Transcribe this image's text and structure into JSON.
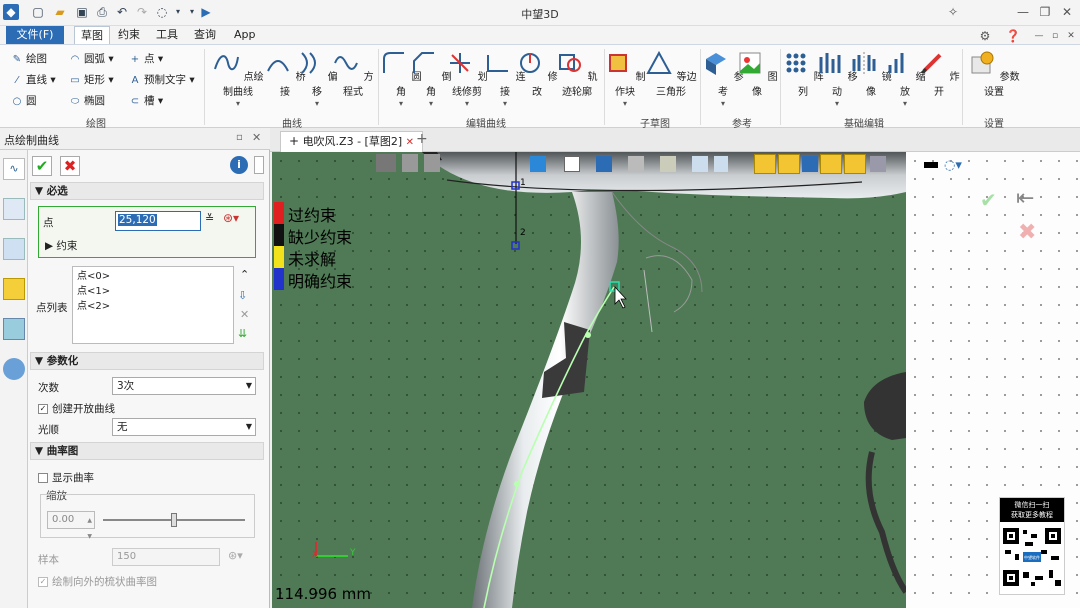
{
  "app": {
    "title": "中望3D"
  },
  "menu": {
    "file": "文件(F)",
    "tabs": [
      "草图",
      "约束",
      "工具",
      "查询",
      "App"
    ]
  },
  "ribbon": {
    "draw": {
      "items": [
        "绘图",
        "圆弧",
        "点",
        "直线",
        "矩形",
        "预制文字",
        "圆",
        "椭圆",
        "槽"
      ],
      "label": "绘图"
    },
    "curve": {
      "items": [
        "点绘制曲线",
        "桥接",
        "偏移",
        "方程式"
      ],
      "label": "曲线"
    },
    "edit": {
      "items": [
        "圆角",
        "倒角",
        "划线修剪",
        "连接",
        "修改",
        "轨迹轮廓"
      ],
      "label": "编辑曲线"
    },
    "subsketch": {
      "items": [
        "制作块",
        "等边三角形"
      ],
      "label": "子草图"
    },
    "ref": {
      "items": [
        "参考",
        "图像"
      ],
      "label": "参考"
    },
    "basic": {
      "items": [
        "阵列",
        "移动",
        "镜像",
        "缩放",
        "炸开"
      ],
      "label": "基础编辑"
    },
    "settings": {
      "items": [
        "参数设置"
      ],
      "label": "设置"
    }
  },
  "panel": {
    "title": "点绘制曲线",
    "required": "必选",
    "point_label": "点",
    "point_value": "25,120",
    "constraint": "约束",
    "points_label": "点列表",
    "points": [
      "点<0>",
      "点<1>",
      "点<2>"
    ],
    "param": "参数化",
    "degree_label": "次数",
    "degree_value": "3次",
    "open_curve": "创建开放曲线",
    "smooth_label": "光顺",
    "smooth_value": "无",
    "curvature": "曲率图",
    "show_curvature": "显示曲率",
    "scale_label": "缩放",
    "scale_value": "0.00",
    "sample_label": "样本",
    "sample_value": "150",
    "outer_comb": "绘制向外的梳状曲率图"
  },
  "doc": {
    "tab": "电吹风.Z3 - [草图2]",
    "add": "+"
  },
  "legend": {
    "items": [
      {
        "label": "过约束",
        "color": "#e02020"
      },
      {
        "label": "缺少约束",
        "color": "#111111"
      },
      {
        "label": "未求解",
        "color": "#f2e21c"
      },
      {
        "label": "明确约束",
        "color": "#2233cc"
      }
    ]
  },
  "viewport": {
    "measure": "114.996 mm",
    "pt1": "1",
    "pt2": "2",
    "axis_y": "Y",
    "axis_x": "X"
  },
  "qr": {
    "line1": "微信扫一扫",
    "line2": "获取更多教程",
    "center": "中望软件"
  }
}
